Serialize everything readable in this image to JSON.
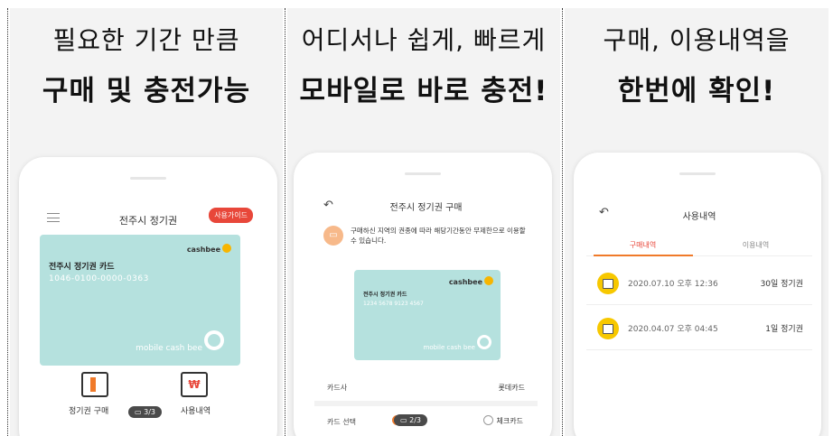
{
  "panels": [
    {
      "headline": [
        "필요한 기간 만큼",
        "구매 및 충전가능"
      ],
      "screen": {
        "title": "전주시 정기권",
        "guide_badge": "사용가이드",
        "card": {
          "name": "전주시 정기권 카드",
          "number": "1046-0100-0000-0363",
          "brand": "cashbee",
          "brand_big": "mobile cash bee"
        },
        "actions": [
          {
            "label": "정기권 구매",
            "icon": "ticket-icon"
          },
          {
            "label": "사용내역",
            "icon": "receipt-won-icon"
          }
        ],
        "page_indicator": "3/3"
      }
    },
    {
      "headline": [
        "어디서나 쉽게, 빠르게",
        "모바일로 바로 충전!"
      ],
      "screen": {
        "title": "전주시 정기권 구매",
        "notice": "구매하신 지역의 권종에 따라 해당기간동안 무제한으로 이용할 수 있습니다.",
        "card": {
          "name": "전주시 정기권 카드",
          "number": "1234 5678 9123 4567",
          "brand": "cashbee",
          "brand_big": "mobile cash bee"
        },
        "rows": [
          {
            "key": "카드사",
            "value": "롯데카드"
          },
          {
            "key": "카드 선택",
            "option_selected": "",
            "option_other": "체크카드"
          }
        ],
        "page_indicator": "2/3"
      }
    },
    {
      "headline": [
        "구매, 이용내역을",
        "한번에 확인!"
      ],
      "screen": {
        "title": "사용내역",
        "tabs": [
          {
            "label": "구매내역",
            "active": true
          },
          {
            "label": "이용내역",
            "active": false
          }
        ],
        "items": [
          {
            "date": "2020.07.10 오후 12:36",
            "kind": "30일 정기권"
          },
          {
            "date": "2020.04.07 오후 04:45",
            "kind": "1일 정기권"
          }
        ]
      }
    }
  ],
  "colors": {
    "accent": "#f07a2a",
    "badge": "#e8473a",
    "card": "#b5e1de",
    "coin": "#f7c800"
  }
}
